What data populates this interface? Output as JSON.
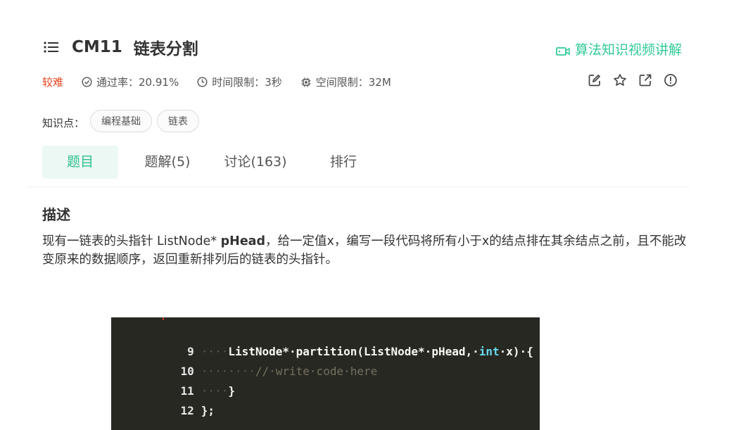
{
  "problem": {
    "code": "CM11",
    "name": "链表分割",
    "difficulty": "较难",
    "pass_rate": "通过率：20.91%",
    "time_limit": "时间限制：3秒",
    "space_limit": "空间限制：32M",
    "video_link": "算法知识视频讲解"
  },
  "tags": {
    "label": "知识点：",
    "items": [
      "编程基础",
      "链表"
    ]
  },
  "tabs": [
    "题目",
    "题解(5)",
    "讨论(163)",
    "排行"
  ],
  "description": {
    "heading": "描述",
    "text_part1": "现有一链表的头指针 ListNode* ",
    "text_bold": "pHead",
    "text_part2": "，给一定值x，编写一段代码将所有小于x的结点排在其余结点之前，且不能改变原来的数据顺序，返回重新排列后的链表的头指针。"
  },
  "code": {
    "lines": [
      {
        "num": "9",
        "indent": "····",
        "text": "ListNode*·partition(ListNode*·pHead,·",
        "kw": "int",
        "rest": "·x)·{"
      },
      {
        "num": "10",
        "indent": "········",
        "comment": "//·write·code·here"
      },
      {
        "num": "11",
        "indent": "····",
        "text": "}"
      },
      {
        "num": "12",
        "indent": "",
        "text": "};"
      }
    ]
  },
  "colors": {
    "accent": "#32ca99",
    "difficulty": "#e8451e",
    "code_bg": "#272822"
  },
  "icons": [
    "menu-icon",
    "video-icon",
    "pass-rate-icon",
    "clock-icon",
    "chip-icon",
    "edit-icon",
    "star-icon",
    "share-icon",
    "info-icon"
  ]
}
